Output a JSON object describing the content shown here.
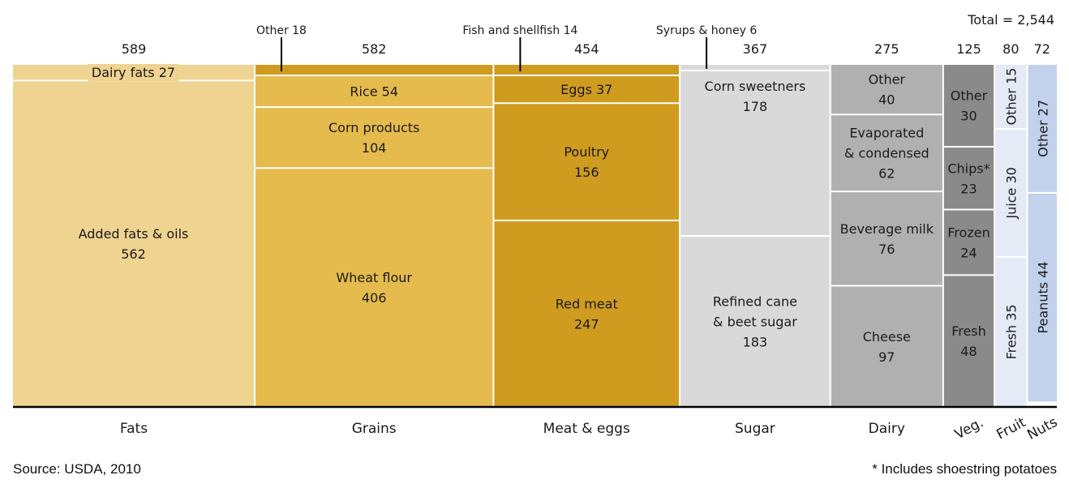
{
  "chart_data": {
    "type": "mekko",
    "title": "",
    "total_label": "Total = 2,544",
    "total": 2544,
    "source": "Source: USDA, 2010",
    "footnote": "* Includes shoestring potatoes",
    "categories": [
      {
        "name": "Fats",
        "total": 589,
        "total_label": "589",
        "label_rotated": false,
        "segments": [
          {
            "name": "Dairy fats",
            "value": 27,
            "lines": [
              "Dairy fats 27"
            ],
            "color": "#efd391",
            "text_color": "#1a1a1a",
            "label_bg": true
          },
          {
            "name": "Added fats & oils",
            "value": 562,
            "lines": [
              "Added fats & oils",
              "562"
            ],
            "color": "#efd391",
            "text_color": "#1a1a1a"
          }
        ]
      },
      {
        "name": "Grains",
        "total": 582,
        "total_label": "582",
        "label_rotated": false,
        "segments": [
          {
            "name": "Other",
            "value": 18,
            "lines": [],
            "callout": "Other 18",
            "color": "#cf9c1f",
            "text_color": "#1a1a1a"
          },
          {
            "name": "Rice",
            "value": 54,
            "lines": [
              "Rice 54"
            ],
            "color": "#e5bb4d",
            "text_color": "#1a1a1a"
          },
          {
            "name": "Corn products",
            "value": 104,
            "lines": [
              "Corn products",
              "104"
            ],
            "color": "#e5bb4d",
            "text_color": "#1a1a1a"
          },
          {
            "name": "Wheat flour",
            "value": 406,
            "lines": [
              "Wheat flour",
              "406"
            ],
            "color": "#e5bb4d",
            "text_color": "#1a1a1a"
          }
        ]
      },
      {
        "name": "Meat & eggs",
        "total": 454,
        "total_label": "454",
        "label_rotated": false,
        "segments": [
          {
            "name": "Fish and shellfish",
            "value": 14,
            "lines": [],
            "callout": "Fish and shellfish  14",
            "color": "#cf9c1f",
            "text_color": "#1a1a1a"
          },
          {
            "name": "Eggs",
            "value": 37,
            "lines": [
              "Eggs 37"
            ],
            "color": "#cf9c1f",
            "text_color": "#1a1a1a"
          },
          {
            "name": "Poultry",
            "value": 156,
            "lines": [
              "Poultry",
              "156"
            ],
            "color": "#cf9c1f",
            "text_color": "#1a1a1a"
          },
          {
            "name": "Red meat",
            "value": 247,
            "lines": [
              "Red meat",
              "247"
            ],
            "color": "#cf9c1f",
            "text_color": "#1a1a1a"
          }
        ]
      },
      {
        "name": "Sugar",
        "total": 367,
        "total_label": "367",
        "label_rotated": false,
        "segments": [
          {
            "name": "Syrups & honey",
            "value": 6,
            "lines": [],
            "callout": "Syrups & honey 6",
            "color": "#d9d9d9",
            "text_color": "#1a1a1a"
          },
          {
            "name": "Corn sweetners",
            "value": 178,
            "lines": [
              "Corn sweetners",
              "178"
            ],
            "color": "#d9d9d9",
            "text_color": "#1a1a1a",
            "valign": "top"
          },
          {
            "name": "Refined cane & beet sugar",
            "value": 183,
            "lines": [
              "Refined cane",
              "& beet sugar",
              "183"
            ],
            "color": "#d9d9d9",
            "text_color": "#1a1a1a"
          }
        ]
      },
      {
        "name": "Dairy",
        "total": 275,
        "total_label": "275",
        "label_rotated": false,
        "segments": [
          {
            "name": "Other",
            "value": 40,
            "lines": [
              "Other",
              "40"
            ],
            "color": "#b0b0b0",
            "text_color": "#1a1a1a"
          },
          {
            "name": "Evaporated & condensed",
            "value": 62,
            "lines": [
              "Evaporated",
              "& condensed",
              "62"
            ],
            "color": "#b0b0b0",
            "text_color": "#1a1a1a"
          },
          {
            "name": "Beverage milk",
            "value": 76,
            "lines": [
              "Beverage milk",
              "76"
            ],
            "color": "#b0b0b0",
            "text_color": "#1a1a1a"
          },
          {
            "name": "Cheese",
            "value": 97,
            "lines": [
              "Cheese",
              "97"
            ],
            "color": "#b0b0b0",
            "text_color": "#1a1a1a"
          }
        ]
      },
      {
        "name": "Veg.",
        "total": 125,
        "total_label": "125",
        "label_rotated": true,
        "segments": [
          {
            "name": "Other",
            "value": 30,
            "lines": [
              "Other",
              "30"
            ],
            "color": "#8a8a8a",
            "text_color": "#ffffff"
          },
          {
            "name": "Chips*",
            "value": 23,
            "lines": [
              "Chips*",
              "23"
            ],
            "color": "#8a8a8a",
            "text_color": "#ffffff"
          },
          {
            "name": "Frozen",
            "value": 24,
            "lines": [
              "Frozen",
              "24"
            ],
            "color": "#8a8a8a",
            "text_color": "#ffffff"
          },
          {
            "name": "Fresh",
            "value": 48,
            "lines": [
              "Fresh",
              "48"
            ],
            "color": "#8a8a8a",
            "text_color": "#ffffff"
          }
        ]
      },
      {
        "name": "Fruit",
        "total": 80,
        "total_label": "80",
        "label_rotated": true,
        "segments": [
          {
            "name": "Other",
            "value": 15,
            "lines": [
              "Other 15"
            ],
            "vertical": true,
            "color": "#e4eaf6",
            "text_color": "#1a1a1a"
          },
          {
            "name": "Juice",
            "value": 30,
            "lines": [
              "Juice 30"
            ],
            "vertical": true,
            "color": "#e4eaf6",
            "text_color": "#1a1a1a"
          },
          {
            "name": "Fresh",
            "value": 35,
            "lines": [
              "Fresh 35"
            ],
            "vertical": true,
            "color": "#e4eaf6",
            "text_color": "#1a1a1a"
          }
        ]
      },
      {
        "name": "Nuts",
        "total": 72,
        "total_label": "72",
        "label_rotated": true,
        "segments": [
          {
            "name": "Other",
            "value": 27,
            "lines": [
              "Other 27"
            ],
            "vertical": true,
            "color": "#c2d1ec",
            "text_color": "#1a1a1a"
          },
          {
            "name": "Peanuts",
            "value": 44,
            "lines": [
              "Peanuts 44"
            ],
            "vertical": true,
            "color": "#c2d1ec",
            "text_color": "#1a1a1a"
          }
        ]
      }
    ]
  }
}
